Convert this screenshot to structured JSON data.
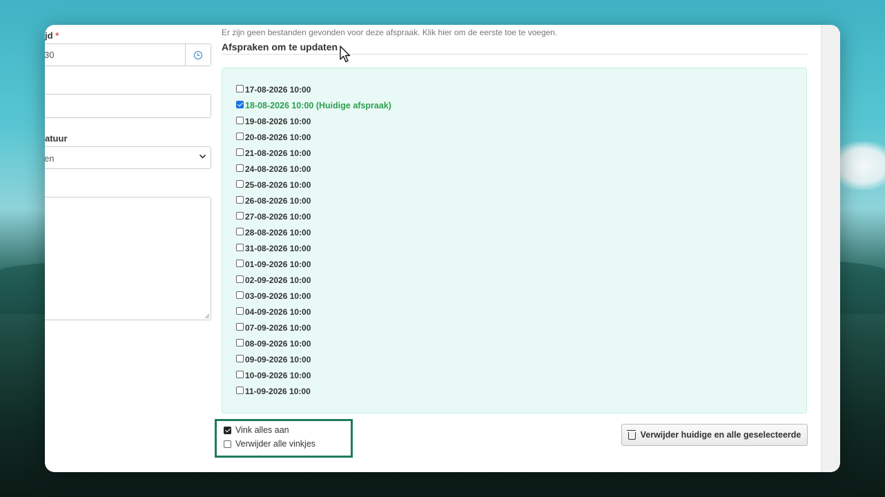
{
  "form": {
    "time_label": "jd",
    "required_mark": "*",
    "time_value": "30",
    "select_label": "atuur",
    "select_value": "en"
  },
  "files_note": "Er zijn geen bestanden gevonden voor deze afspraak. Klik hier om de eerste toe te voegen.",
  "section_title": "Afspraken om te updaten",
  "appointments": [
    {
      "label": "17-08-2026 10:00",
      "checked": false
    },
    {
      "label": "18-08-2026 10:00 (Huidige afspraak)",
      "checked": true,
      "current": true
    },
    {
      "label": "19-08-2026 10:00",
      "checked": false
    },
    {
      "label": "20-08-2026 10:00",
      "checked": false
    },
    {
      "label": "21-08-2026 10:00",
      "checked": false
    },
    {
      "label": "24-08-2026 10:00",
      "checked": false
    },
    {
      "label": "25-08-2026 10:00",
      "checked": false
    },
    {
      "label": "26-08-2026 10:00",
      "checked": false
    },
    {
      "label": "27-08-2026 10:00",
      "checked": false
    },
    {
      "label": "28-08-2026 10:00",
      "checked": false
    },
    {
      "label": "31-08-2026 10:00",
      "checked": false
    },
    {
      "label": "01-09-2026 10:00",
      "checked": false
    },
    {
      "label": "02-09-2026 10:00",
      "checked": false
    },
    {
      "label": "03-09-2026 10:00",
      "checked": false
    },
    {
      "label": "04-09-2026 10:00",
      "checked": false
    },
    {
      "label": "07-09-2026 10:00",
      "checked": false
    },
    {
      "label": "08-09-2026 10:00",
      "checked": false
    },
    {
      "label": "09-09-2026 10:00",
      "checked": false
    },
    {
      "label": "10-09-2026 10:00",
      "checked": false
    },
    {
      "label": "11-09-2026 10:00",
      "checked": false
    }
  ],
  "toggles": {
    "check_all": {
      "label": "Vink alles aan",
      "checked": true
    },
    "uncheck_all": {
      "label": "Verwijder alle vinkjes",
      "checked": false
    }
  },
  "delete_button": "Verwijder huidige en alle geselecteerde",
  "icons": {
    "clock": "clock-icon",
    "trash": "trash-icon",
    "chevron": "chevron-down-icon",
    "cursor": "mouse-cursor-icon"
  },
  "colors": {
    "current_appointment": "#2e9e4f",
    "list_background": "#e9faf6",
    "highlight_border": "#1f7a5b",
    "checkbox_checked": "#1a73e8"
  }
}
